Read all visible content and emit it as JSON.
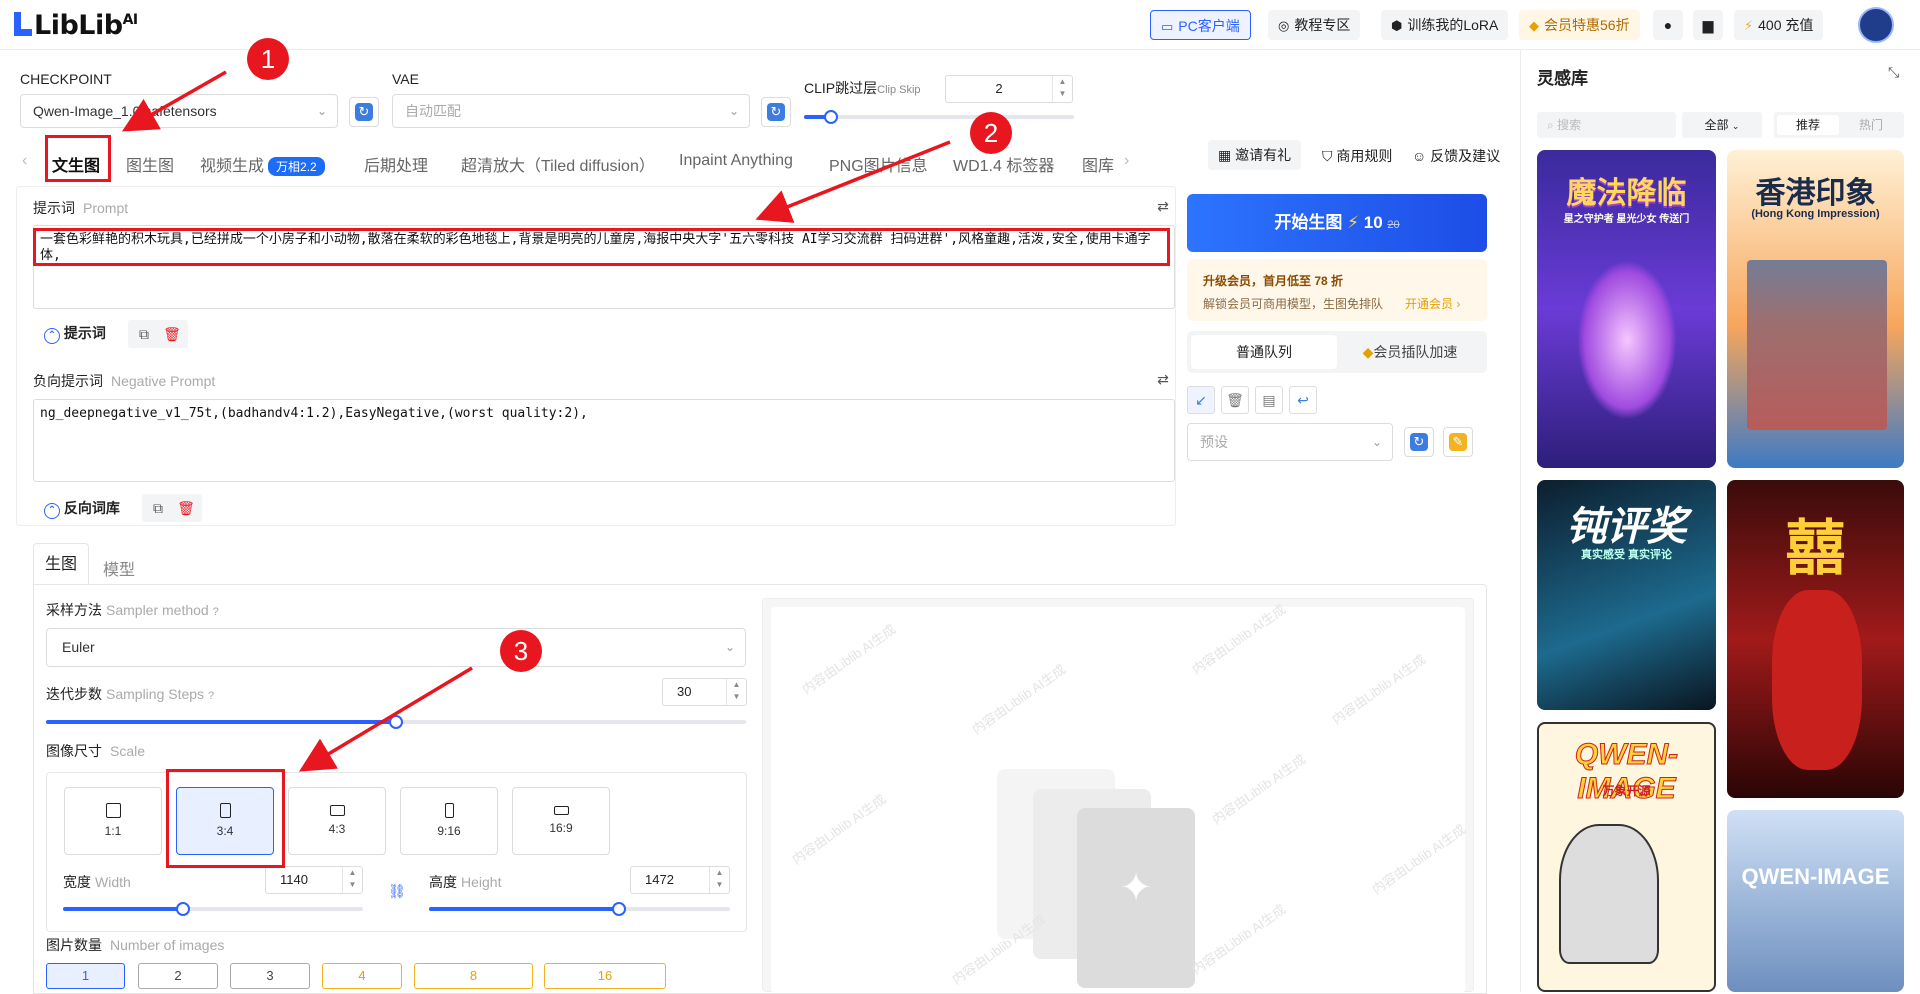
{
  "header": {
    "logo": "LibLib",
    "logo_ai": "AI",
    "buttons": [
      "PC客户端",
      "教程专区",
      "训练我的LoRA",
      "会员特惠56折"
    ],
    "recharge": "400 充值"
  },
  "checkpoint": {
    "label": "CHECKPOINT",
    "value": "Qwen-Image_1.0.safetensors"
  },
  "vae": {
    "label": "VAE",
    "placeholder": "自动匹配"
  },
  "clip": {
    "label": "CLIP跳过层",
    "sub": "Clip Skip",
    "value": "2",
    "level": 0.1
  },
  "tabs": [
    "文生图",
    "图生图",
    "视频生成",
    "后期处理",
    "超清放大（Tiled diffusion）",
    "Inpaint Anything",
    "PNG图片信息",
    "WD1.4 标签器",
    "图库"
  ],
  "tab_badge": "万相2.2",
  "right_links": [
    "邀请有礼",
    "商用规则",
    "反馈及建议"
  ],
  "prompt": {
    "label": "提示词",
    "sub": "Prompt",
    "value": "一套色彩鲜艳的积木玩具,已经拼成一个小房子和小动物,散落在柔软的彩色地毯上,背景是明亮的儿童房,海报中央大字'五六零科技 AI学习交流群 扫码进群',风格童趣,活泼,安全,使用卡通字体,",
    "library": "提示词"
  },
  "negative": {
    "label": "负向提示词",
    "sub": "Negative Prompt",
    "value": "ng_deepnegative_v1_75t,(badhandv4:1.2),EasyNegative,(worst quality:2),",
    "library": "反向词库"
  },
  "generate": {
    "label": "开始生图",
    "cost": "10",
    "old_cost": "20",
    "vip_title": "升级会员，首月低至 78 折",
    "vip_desc": "解锁会员可商用模型，生图免排队",
    "vip_link": "开通会员 ›",
    "queue_normal": "普通队列",
    "queue_vip": "会员插队加速",
    "preset_placeholder": "预设"
  },
  "subtabs": [
    "生图",
    "模型"
  ],
  "sampler": {
    "label": "采样方法",
    "sub": "Sampler method",
    "value": "Euler"
  },
  "steps": {
    "label": "迭代步数",
    "sub": "Sampling Steps",
    "value": "30",
    "level": 0.5
  },
  "size": {
    "label": "图像尺寸",
    "sub": "Scale",
    "ratios": [
      "1:1",
      "3:4",
      "4:3",
      "9:16",
      "16:9"
    ],
    "width_label": "宽度",
    "width_sub": "Width",
    "width": "1140",
    "width_level": 0.4,
    "height_label": "高度",
    "height_sub": "Height",
    "height": "1472",
    "height_level": 0.63
  },
  "count": {
    "label": "图片数量",
    "sub": "Number of images",
    "options": [
      "1",
      "2",
      "3",
      "4",
      "8",
      "16"
    ]
  },
  "watermark": "内容由Liblib AI生成",
  "annotations": [
    "1",
    "2",
    "3"
  ],
  "inspiration": {
    "title": "灵感库",
    "search_placeholder": "搜索",
    "filter": "全部",
    "tabs": [
      "推荐",
      "热门"
    ],
    "cards": [
      {
        "title": "魔法降临",
        "sub": "星之守护者 星光少女 传送门"
      },
      {
        "title": "香港印象",
        "sub": "(Hong Kong Impression)"
      },
      {
        "title": "钝评奖",
        "sub": "真实感受 真实评论"
      },
      {
        "title": "囍",
        "sub": ""
      },
      {
        "title": "QWEN-IMAGE",
        "sub": "万象开源"
      },
      {
        "title": "QWEN-IMAGE",
        "sub": ""
      }
    ]
  }
}
